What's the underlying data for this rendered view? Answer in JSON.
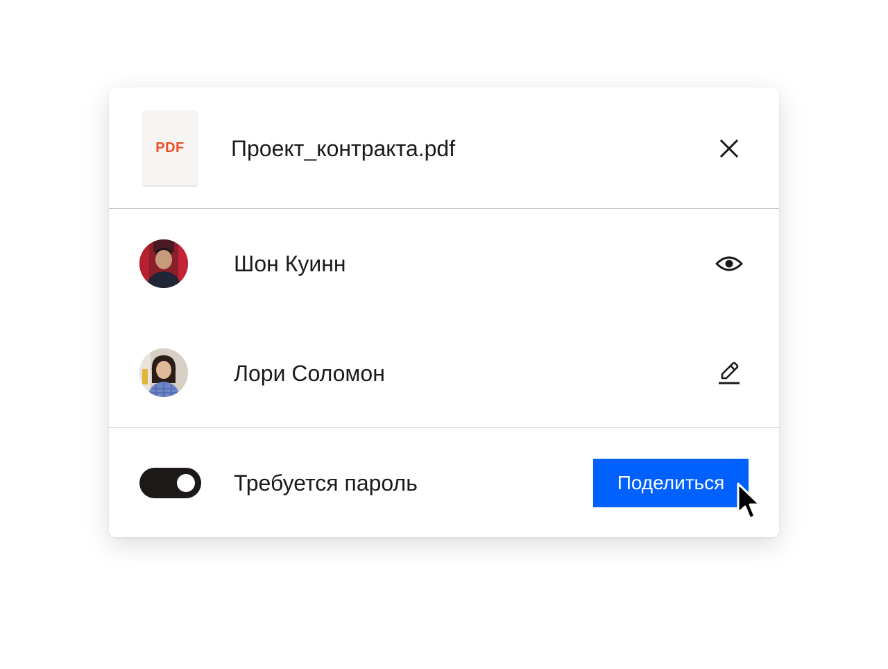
{
  "file": {
    "type_label": "PDF",
    "name": "Проект_контракта.pdf",
    "close_icon": "close-icon"
  },
  "people": [
    {
      "name": "Шон Куинн",
      "permission_icon": "eye-icon"
    },
    {
      "name": "Лори Соломон",
      "permission_icon": "pencil-icon"
    }
  ],
  "footer": {
    "password_toggle_label": "Требуется пароль",
    "password_toggle_on": true,
    "share_label": "Поделиться"
  },
  "colors": {
    "accent": "#0061fe",
    "pdf_label": "#e9502a",
    "text": "#1e1919",
    "toggle_on": "#1e1919"
  }
}
